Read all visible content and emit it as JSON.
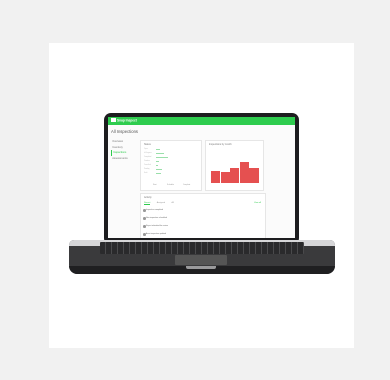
{
  "app": {
    "brand": "Snap Inspect",
    "page_title": "All Inspections"
  },
  "sidebar": {
    "items": [
      {
        "label": "Overview"
      },
      {
        "label": "Inventory"
      },
      {
        "label": "Inspections"
      },
      {
        "label": "Assessments"
      }
    ]
  },
  "panel_status": {
    "title": "Status",
    "rows": [
      "Open",
      "In Progress",
      "Completed",
      "Overdue",
      "Cancelled",
      "Pending",
      "Draft"
    ],
    "buttons": [
      "Start",
      "Schedule",
      "Complete"
    ]
  },
  "panel_chart": {
    "title": "Inspections by month"
  },
  "panel_activity": {
    "title": "Activity",
    "tabs": [
      "Recent",
      "Assigned",
      "All"
    ],
    "link": "View all",
    "items": [
      "Inspection completed",
      "New inspection scheduled",
      "Report submitted for review",
      "Asset inspection updated"
    ]
  },
  "chart_data": {
    "type": "bar",
    "values": [
      9,
      8,
      11,
      16,
      11
    ],
    "ylim": [
      0,
      18
    ],
    "color": "#e55050"
  },
  "colors": {
    "brand_green": "#2ecc4e",
    "bar_red": "#e55050",
    "background": "#f1f1f1"
  }
}
